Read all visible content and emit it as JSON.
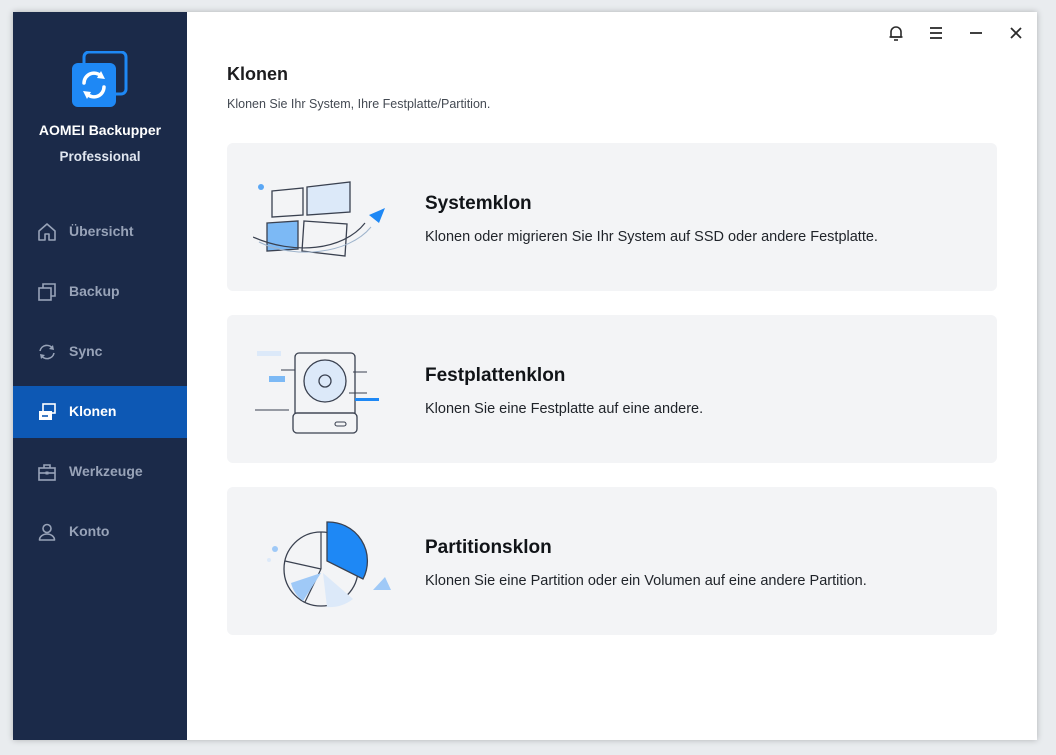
{
  "app": {
    "name": "AOMEI Backupper",
    "edition": "Professional"
  },
  "sidebar": {
    "items": [
      {
        "label": "Übersicht",
        "icon": "home-icon"
      },
      {
        "label": "Backup",
        "icon": "copy-icon"
      },
      {
        "label": "Sync",
        "icon": "sync-icon"
      },
      {
        "label": "Klonen",
        "icon": "clone-icon",
        "active": true
      },
      {
        "label": "Werkzeuge",
        "icon": "toolbox-icon"
      },
      {
        "label": "Konto",
        "icon": "user-icon"
      }
    ]
  },
  "titlebar": {
    "icons": [
      "bell-icon",
      "menu-icon",
      "minimize-icon",
      "close-icon"
    ]
  },
  "main": {
    "title": "Klonen",
    "subtitle": "Klonen Sie Ihr System, Ihre Festplatte/Partition.",
    "cards": [
      {
        "title": "Systemklon",
        "description": "Klonen oder migrieren Sie Ihr System auf SSD oder andere Festplatte.",
        "icon": "system-clone-illustration"
      },
      {
        "title": "Festplattenklon",
        "description": "Klonen Sie eine Festplatte auf eine andere.",
        "icon": "disk-clone-illustration"
      },
      {
        "title": "Partitionsklon",
        "description": "Klonen Sie eine Partition oder ein Volumen auf eine andere Partition.",
        "icon": "partition-clone-illustration"
      }
    ]
  },
  "colors": {
    "sidebar_bg": "#1b2a49",
    "active_bg": "#0d58b4",
    "accent": "#1e88f5",
    "card_bg": "#f3f4f6"
  }
}
